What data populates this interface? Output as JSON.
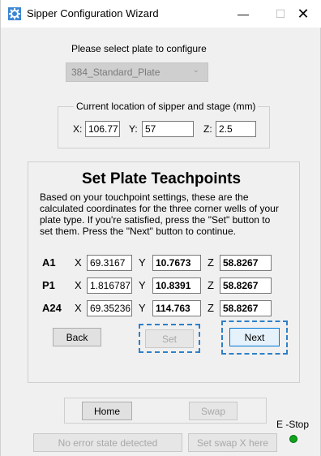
{
  "window": {
    "title": "Sipper Configuration Wizard",
    "min_glyph": "—",
    "max_glyph": "☐",
    "close_glyph": "✕"
  },
  "plate": {
    "prompt": "Please select plate to configure",
    "selected": "384_Standard_Plate"
  },
  "location": {
    "group_title": "Current location of sipper and stage (mm)",
    "x_label": "X:",
    "x_value": "106.77",
    "y_label": "Y:",
    "y_value": "57",
    "z_label": "Z:",
    "z_value": "2.5"
  },
  "teachpoints": {
    "title": "Set Plate Teachpoints",
    "instructions": "Based on your touchpoint settings, these are the calculated coordinates for the three corner wells of your plate type. If you're satisfied, press the \"Set\" button to set them. Press the \"Next\" button to continue.",
    "axis_x": "X",
    "axis_y": "Y",
    "axis_z": "Z",
    "rows": [
      {
        "well": "A1",
        "x": "69.3167",
        "y": "10.7673",
        "z": "58.8267"
      },
      {
        "well": "P1",
        "x": "1.816787",
        "y": "10.8391",
        "z": "58.8267"
      },
      {
        "well": "A24",
        "x": "69.35236",
        "y": "114.763",
        "z": "58.8267"
      }
    ],
    "back_label": "Back",
    "set_label": "Set",
    "next_label": "Next"
  },
  "footer": {
    "home_label": "Home",
    "swap_label": "Swap",
    "estop_label": "E -Stop",
    "error_state": "No error state detected",
    "set_swap_label": "Set swap X here"
  },
  "colors": {
    "accent": "#2f80c8",
    "estop_led": "#0fa31b"
  }
}
